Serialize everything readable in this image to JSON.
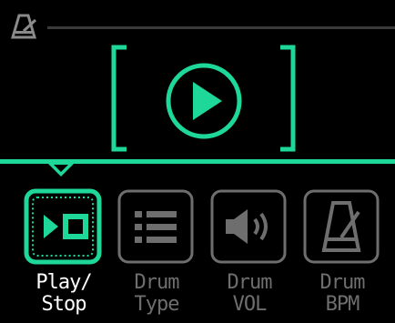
{
  "colors": {
    "accent": "#1ed89a",
    "inactive": "#6e6e6e",
    "active_label": "#ffffff",
    "background": "#000000"
  },
  "header": {
    "icon": "metronome-icon"
  },
  "main": {
    "state_icon": "play-icon",
    "frame": "bracket-frame"
  },
  "menu": {
    "selected_index": 0,
    "items": [
      {
        "label": "Play/\nStop",
        "icon": "play-stop-icon",
        "active": true
      },
      {
        "label": "Drum\nType",
        "icon": "list-icon",
        "active": false
      },
      {
        "label": "Drum\nVOL",
        "icon": "volume-icon",
        "active": false
      },
      {
        "label": "Drum\nBPM",
        "icon": "metronome-icon",
        "active": false
      }
    ]
  }
}
